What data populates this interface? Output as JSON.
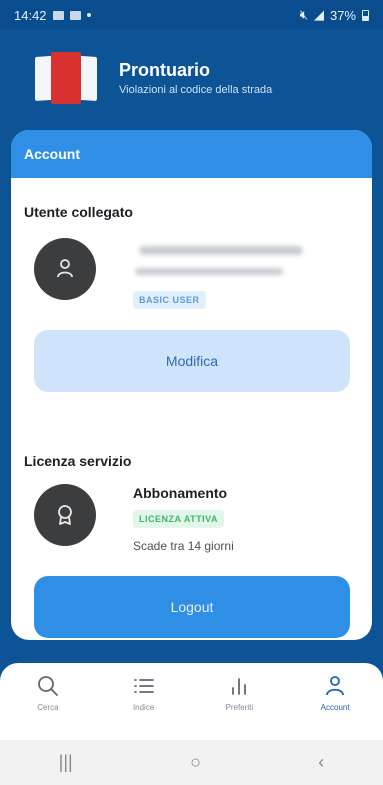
{
  "status_bar": {
    "time": "14:42",
    "battery": "37%"
  },
  "header": {
    "title": "Prontuario",
    "subtitle": "Violazioni al codice della strada"
  },
  "card": {
    "title": "Account",
    "user_section": {
      "heading": "Utente collegato",
      "role_badge": "BASIC USER",
      "edit_button": "Modifica"
    },
    "license_section": {
      "heading": "Licenza servizio",
      "plan": "Abbonamento",
      "status_badge": "LICENZA ATTIVA",
      "expiry": "Scade tra 14 giorni"
    },
    "logout_button": "Logout"
  },
  "bottom_nav": {
    "items": [
      {
        "label": "Cerca",
        "icon": "search-icon"
      },
      {
        "label": "Indice",
        "icon": "list-icon"
      },
      {
        "label": "Preferiti",
        "icon": "bar-chart-icon"
      },
      {
        "label": "Account",
        "icon": "person-icon",
        "active": true
      }
    ]
  },
  "system_nav": {
    "recents": "|||",
    "home": "○",
    "back": "‹"
  },
  "colors": {
    "primary": "#0d5497",
    "accent": "#2f8fe6",
    "active_badge_green": "#3eb56b",
    "book_red": "#d8312f"
  }
}
